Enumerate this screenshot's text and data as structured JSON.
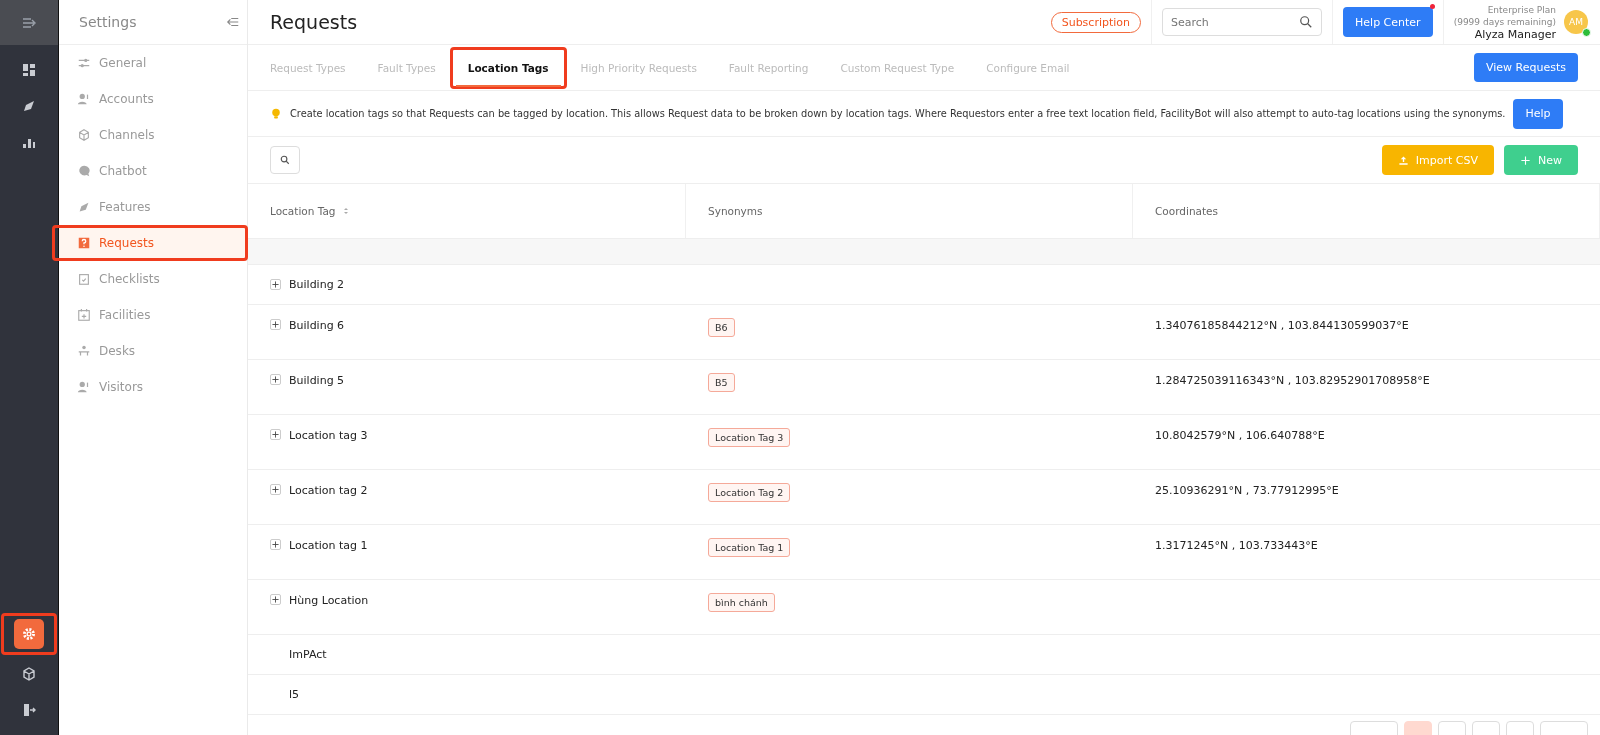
{
  "rail": {
    "items": [
      {
        "selected": false,
        "highlighted": false
      },
      {
        "selected": false,
        "highlighted": false
      },
      {
        "selected": false,
        "highlighted": false
      }
    ],
    "bottom_items": [
      {
        "selected": true,
        "highlighted": true
      },
      {
        "selected": false,
        "highlighted": false
      },
      {
        "selected": false,
        "highlighted": false
      }
    ]
  },
  "sidebar": {
    "title": "Settings",
    "items": [
      {
        "label": "General",
        "selected": false,
        "highlighted": false
      },
      {
        "label": "Accounts",
        "selected": false,
        "highlighted": false
      },
      {
        "label": "Channels",
        "selected": false,
        "highlighted": false
      },
      {
        "label": "Chatbot",
        "selected": false,
        "highlighted": false
      },
      {
        "label": "Features",
        "selected": false,
        "highlighted": false
      },
      {
        "label": "Requests",
        "selected": true,
        "highlighted": true
      },
      {
        "label": "Checklists",
        "selected": false,
        "highlighted": false
      },
      {
        "label": "Facilities",
        "selected": false,
        "highlighted": false
      },
      {
        "label": "Desks",
        "selected": false,
        "highlighted": false
      },
      {
        "label": "Visitors",
        "selected": false,
        "highlighted": false
      }
    ]
  },
  "header": {
    "title": "Requests",
    "subscription": "Subscription",
    "search": {
      "placeholder": "Search"
    },
    "help_center": "Help Center",
    "help_center_notification": true,
    "plan": "Enterprise Plan",
    "plan_remaining": "(9999 days remaining)",
    "user_name": "Alyza Manager",
    "avatar_initials": "AM",
    "online": true
  },
  "tabs": [
    {
      "label": "Request Types",
      "selected": false,
      "highlighted": false
    },
    {
      "label": "Fault Types",
      "selected": false,
      "highlighted": false
    },
    {
      "label": "Location Tags",
      "selected": true,
      "highlighted": true
    },
    {
      "label": "High Priority Requests",
      "selected": false,
      "highlighted": false
    },
    {
      "label": "Fault Reporting",
      "selected": false,
      "highlighted": false
    },
    {
      "label": "Custom Request Type",
      "selected": false,
      "highlighted": false
    },
    {
      "label": "Configure Email",
      "selected": false,
      "highlighted": false
    }
  ],
  "view_requests": "View Requests",
  "info": {
    "text": "Create location tags so that Requests can be tagged by location. This allows Request data to be broken down by location tags. Where Requestors enter a free text location field, FacilityBot will also attempt to auto-tag locations using the synonyms.",
    "help": "Help"
  },
  "toolbar": {
    "import_csv": "Import CSV",
    "new": "New"
  },
  "table": {
    "columns": [
      "Location Tag",
      "Synonyms",
      "Coordinates"
    ],
    "rows": [
      {
        "name": "Building 2",
        "expandable": true,
        "synonyms": [],
        "coordinates": ""
      },
      {
        "name": "Building 6",
        "expandable": true,
        "synonyms": [
          "B6"
        ],
        "coordinates": "1.34076185844212°N , 103.844130599037°E"
      },
      {
        "name": "Building 5",
        "expandable": true,
        "synonyms": [
          "B5"
        ],
        "coordinates": "1.284725039116343°N , 103.82952901708958°E"
      },
      {
        "name": "Location tag 3",
        "expandable": true,
        "synonyms": [
          "Location Tag 3"
        ],
        "coordinates": "10.8042579°N , 106.640788°E"
      },
      {
        "name": "Location tag 2",
        "expandable": true,
        "synonyms": [
          "Location Tag 2"
        ],
        "coordinates": "25.10936291°N , 73.77912995°E"
      },
      {
        "name": "Location tag 1",
        "expandable": true,
        "synonyms": [
          "Location Tag 1"
        ],
        "coordinates": "1.3171245°N , 103.733443°E"
      },
      {
        "name": "Hùng Location",
        "expandable": true,
        "synonyms": [
          "bình chánh"
        ],
        "coordinates": ""
      },
      {
        "name": "ImPAct",
        "expandable": false,
        "synonyms": [],
        "coordinates": ""
      },
      {
        "name": "l5",
        "expandable": false,
        "synonyms": [],
        "coordinates": ""
      }
    ]
  },
  "pagination": [
    {
      "selected": false
    },
    {
      "selected": true
    },
    {
      "selected": false
    },
    {
      "selected": false
    },
    {
      "selected": false
    },
    {
      "selected": false
    }
  ]
}
